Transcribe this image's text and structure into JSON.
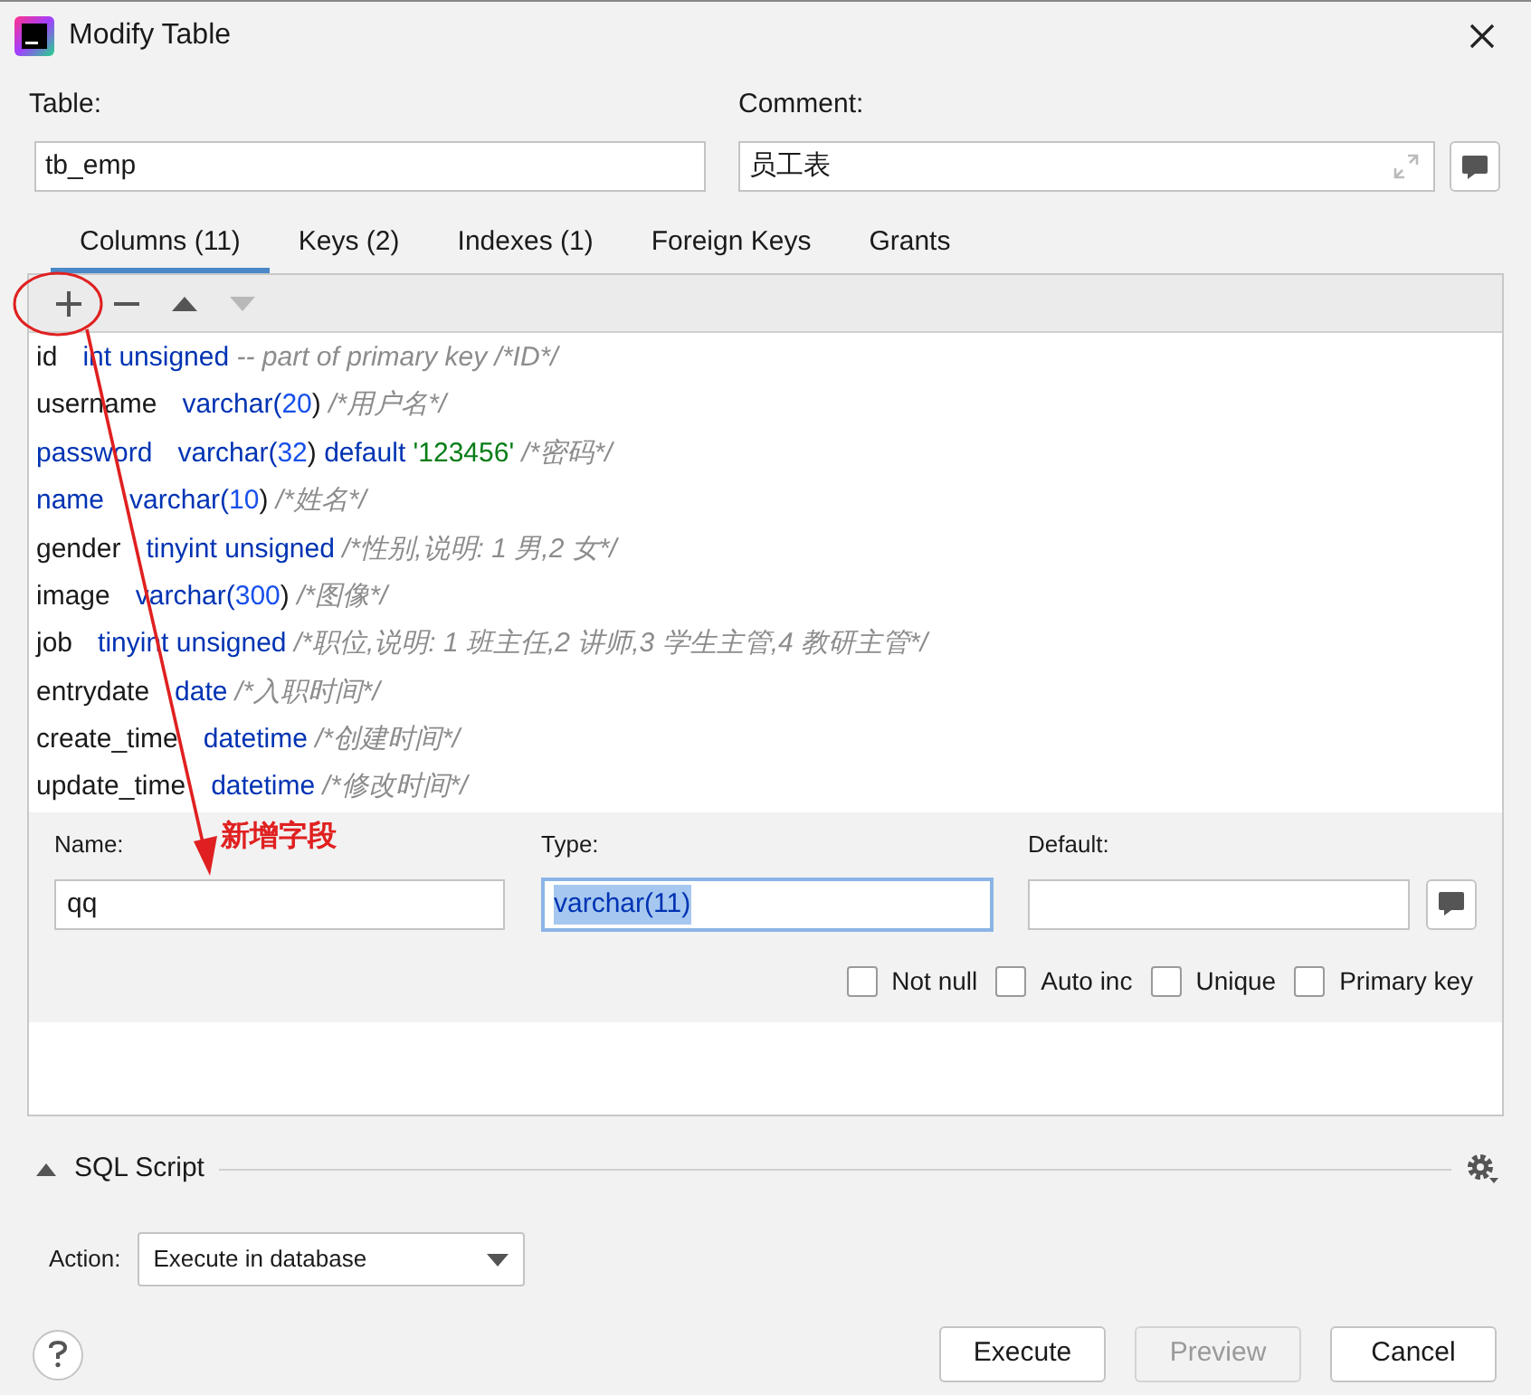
{
  "window": {
    "title": "Modify Table"
  },
  "table_field": {
    "label": "Table:",
    "value": "tb_emp"
  },
  "comment_field": {
    "label": "Comment:",
    "value": "员工表"
  },
  "tabs": [
    {
      "label": "Columns (11)",
      "selected": true
    },
    {
      "label": "Keys (2)",
      "selected": false
    },
    {
      "label": "Indexes (1)",
      "selected": false
    },
    {
      "label": "Foreign Keys",
      "selected": false
    },
    {
      "label": "Grants",
      "selected": false
    }
  ],
  "toolbar": [
    {
      "kind": "add",
      "disabled": false
    },
    {
      "kind": "remove",
      "disabled": false
    },
    {
      "kind": "up",
      "disabled": false
    },
    {
      "kind": "down",
      "disabled": true
    }
  ],
  "columns": [
    {
      "name": {
        "kind": "plain",
        "text": "id"
      },
      "definition": [
        {
          "kind": "keyword",
          "text": "int unsigned"
        },
        {
          "kind": "comment",
          "text": " -- part of primary key /*ID*/"
        }
      ]
    },
    {
      "name": {
        "kind": "plain",
        "text": "username"
      },
      "definition": [
        {
          "kind": "keyword",
          "text": "varchar("
        },
        {
          "kind": "number",
          "text": "20"
        },
        {
          "kind": "plain",
          "text": ")"
        },
        {
          "kind": "comment",
          "text": " /*用户名*/"
        }
      ]
    },
    {
      "name": {
        "kind": "keyword",
        "text": "password"
      },
      "definition": [
        {
          "kind": "keyword",
          "text": "varchar("
        },
        {
          "kind": "number",
          "text": "32"
        },
        {
          "kind": "plain",
          "text": ")"
        },
        {
          "kind": "keyword",
          "text": " default "
        },
        {
          "kind": "string",
          "text": "'123456'"
        },
        {
          "kind": "comment",
          "text": " /*密码*/"
        }
      ]
    },
    {
      "name": {
        "kind": "keyword",
        "text": "name"
      },
      "definition": [
        {
          "kind": "keyword",
          "text": "varchar("
        },
        {
          "kind": "number",
          "text": "10"
        },
        {
          "kind": "plain",
          "text": ")"
        },
        {
          "kind": "comment",
          "text": " /*姓名*/"
        }
      ]
    },
    {
      "name": {
        "kind": "plain",
        "text": "gender"
      },
      "definition": [
        {
          "kind": "keyword",
          "text": "tinyint unsigned"
        },
        {
          "kind": "comment",
          "text": " /*性别,说明: 1 男,2 女*/"
        }
      ]
    },
    {
      "name": {
        "kind": "plain",
        "text": "image"
      },
      "definition": [
        {
          "kind": "keyword",
          "text": "varchar("
        },
        {
          "kind": "number",
          "text": "300"
        },
        {
          "kind": "plain",
          "text": ")"
        },
        {
          "kind": "comment",
          "text": " /*图像*/"
        }
      ]
    },
    {
      "name": {
        "kind": "plain",
        "text": "job"
      },
      "definition": [
        {
          "kind": "keyword",
          "text": "tinyint unsigned"
        },
        {
          "kind": "comment",
          "text": " /*职位,说明: 1 班主任,2 讲师,3 学生主管,4 教研主管*/"
        }
      ]
    },
    {
      "name": {
        "kind": "plain",
        "text": "entrydate"
      },
      "definition": [
        {
          "kind": "keyword",
          "text": "date"
        },
        {
          "kind": "comment",
          "text": " /*入职时间*/"
        }
      ]
    },
    {
      "name": {
        "kind": "plain",
        "text": "create_time"
      },
      "definition": [
        {
          "kind": "keyword",
          "text": "datetime"
        },
        {
          "kind": "comment",
          "text": " /*创建时间*/"
        }
      ]
    },
    {
      "name": {
        "kind": "plain",
        "text": "update_time"
      },
      "definition": [
        {
          "kind": "keyword",
          "text": "datetime"
        },
        {
          "kind": "comment",
          "text": " /*修改时间*/"
        }
      ]
    }
  ],
  "editor": {
    "name_label": "Name:",
    "name_value": "qq",
    "type_label": "Type:",
    "type_value": "varchar(11)",
    "default_label": "Default:",
    "checkboxes": [
      {
        "label": "Not null",
        "checked": false
      },
      {
        "label": "Auto inc",
        "checked": false
      },
      {
        "label": "Unique",
        "checked": false
      },
      {
        "label": "Primary key",
        "checked": false
      }
    ]
  },
  "annotation": {
    "text": "新增字段"
  },
  "sql_script": {
    "title": "SQL Script",
    "expanded": true,
    "action_label": "Action:",
    "action_value": "Execute in database"
  },
  "buttons": [
    {
      "label": "Execute",
      "disabled": false
    },
    {
      "label": "Preview",
      "disabled": true
    },
    {
      "label": "Cancel",
      "disabled": false
    }
  ]
}
